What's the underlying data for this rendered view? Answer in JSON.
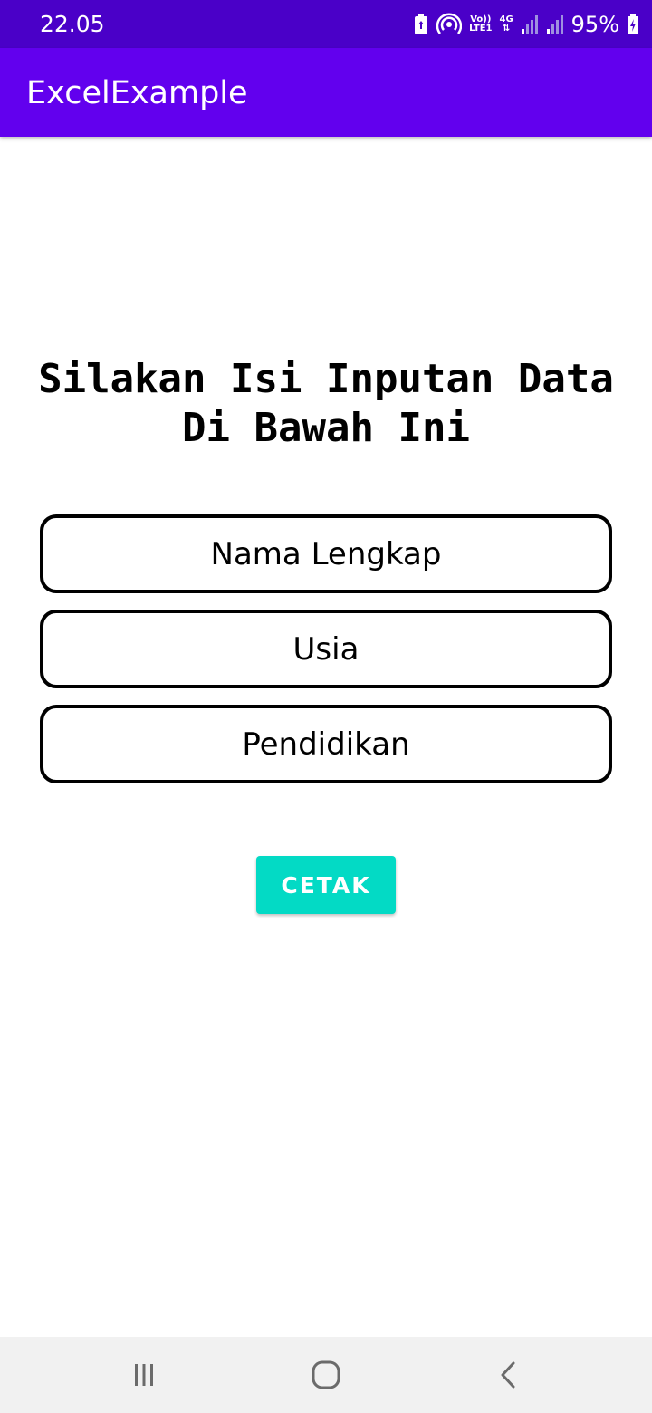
{
  "status_bar": {
    "time": "22.05",
    "volte_label": "Vo))",
    "lte_label": "LTE1",
    "net_label": "4G",
    "battery_percent": "95%",
    "icons": [
      "battery-saver-icon",
      "hotspot-icon",
      "volte-icon",
      "4g-data-icon",
      "signal-sim1-icon",
      "signal-sim2-icon",
      "battery-charging-icon"
    ]
  },
  "app_bar": {
    "title": "ExcelExample",
    "color": "#6200ee"
  },
  "form": {
    "heading": "Silakan Isi Inputan Data Di Bawah Ini",
    "fields": [
      {
        "placeholder": "Nama Lengkap",
        "value": ""
      },
      {
        "placeholder": "Usia",
        "value": ""
      },
      {
        "placeholder": "Pendidikan",
        "value": ""
      }
    ],
    "submit_label": "CETAK",
    "submit_color": "#03dac5"
  },
  "nav_bar": {
    "icons": [
      "recent-apps-icon",
      "home-icon",
      "back-icon"
    ]
  }
}
